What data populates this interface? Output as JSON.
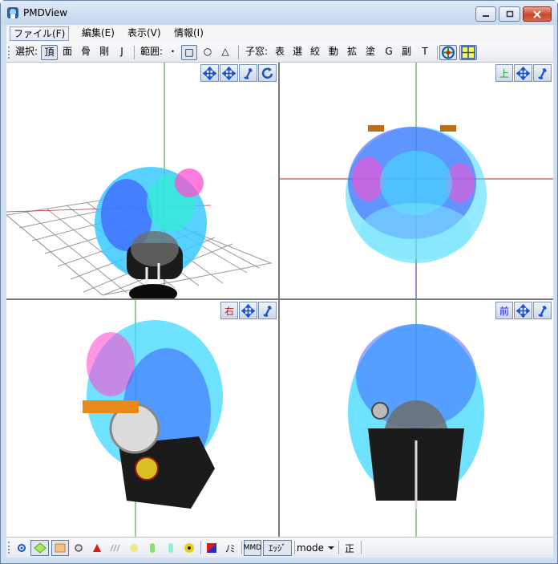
{
  "window": {
    "title": "PMDView"
  },
  "menu": {
    "items": [
      "ファイル(F)",
      "編集(E)",
      "表示(V)",
      "情報(I)"
    ]
  },
  "toolbar": {
    "select_label": "選択:",
    "select_items": [
      "頂",
      "面",
      "骨",
      "剛",
      "J"
    ],
    "range_label": "範囲:",
    "range_items": [
      "・",
      "□",
      "○",
      "△"
    ],
    "child_label": "子窓:",
    "child_items": [
      "表",
      "選",
      "絞",
      "動",
      "拡",
      "塗",
      "G",
      "副",
      "T"
    ]
  },
  "viewports": {
    "top_label": "上",
    "right_label": "右",
    "front_label": "前"
  },
  "bottombar": {
    "noise_label": "ﾉﾐ",
    "mmd_label": "MMD",
    "edge_label": "ｴｯｼﾞ",
    "mode_label": "mode",
    "correct_label": "正"
  },
  "colors": {
    "title_bg": "#c5d7ee",
    "axis_green": "#2e9e2e",
    "axis_red": "#d01818",
    "axis_blue": "#2020c8",
    "hair_cyan": "#3fd8ff",
    "hair_blue": "#3a5cff",
    "hair_pink": "#ff4fd0"
  }
}
